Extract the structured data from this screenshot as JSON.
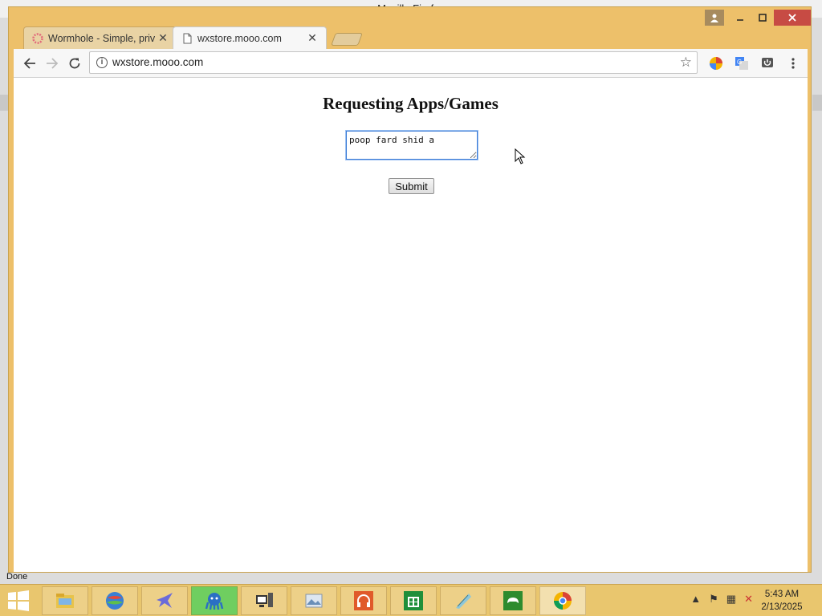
{
  "os": {
    "underlying_window_title": "Mozilla Firefox",
    "underlying_status": "Done"
  },
  "browser": {
    "tabs": [
      {
        "label": "Wormhole - Simple, priv",
        "favicon": "wormhole-icon",
        "active": false
      },
      {
        "label": "wxstore.mooo.com",
        "favicon": "page-icon",
        "active": true
      }
    ],
    "url": "wxstore.mooo.com"
  },
  "page": {
    "title": "Requesting Apps/Games",
    "textarea_value": "poop fard shid a ",
    "submit_label": "Submit"
  },
  "taskbar": {
    "items": [
      "file-explorer-icon",
      "browser-ball-icon",
      "blue-bird-icon",
      "octopus-app-icon",
      "computer-icon",
      "photo-viewer-icon",
      "headphones-icon",
      "store-icon",
      "feather-app-icon",
      "xbox-icon",
      "chrome-icon"
    ],
    "time": "5:43 AM",
    "date": "2/13/2025"
  },
  "colors": {
    "window_frame": "#edc06a",
    "close_button": "#c74b44",
    "textarea_focus": "#3b7bd6"
  }
}
